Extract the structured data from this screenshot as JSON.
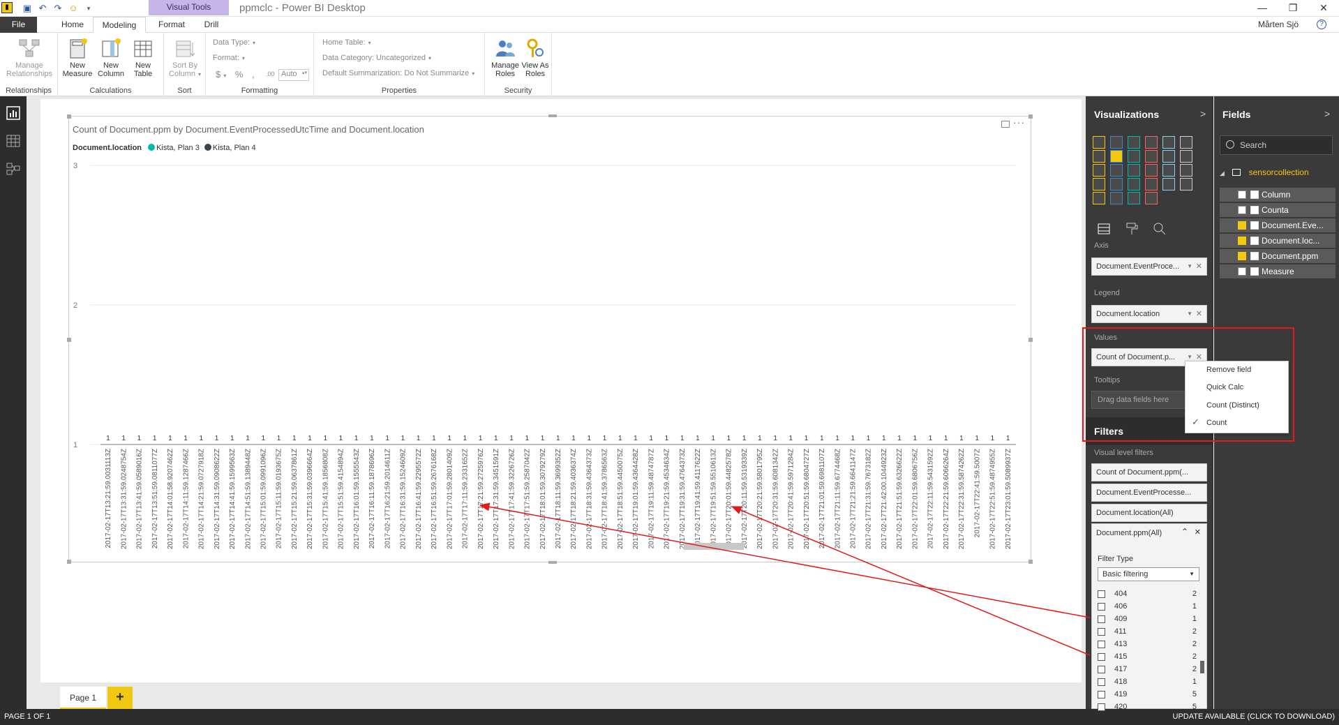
{
  "titlebar": {
    "app_icon": "pbi",
    "context_tab": "Visual Tools",
    "title": "ppmclc - Power BI Desktop",
    "quick_access": [
      "save-icon",
      "undo-icon",
      "redo-icon",
      "smiley-icon"
    ],
    "window_buttons": [
      "—",
      "❐",
      "✕"
    ]
  },
  "ribbon_tabs": [
    "File",
    "Home",
    "Modeling",
    "Format",
    "Drill"
  ],
  "user_name": "Mårten Sjö",
  "ribbon": {
    "relationships": {
      "button": "Manage Relationships",
      "group": "Relationships"
    },
    "calculations": {
      "new_measure": "New Measure",
      "new_column": "New Column",
      "new_table": "New Table",
      "group": "Calculations"
    },
    "sort": {
      "button": "Sort By Column",
      "group": "Sort"
    },
    "formatting": {
      "data_type": "Data Type:",
      "format": "Format:",
      "currency": "$",
      "percent": "%",
      "comma": ",",
      "decimals": ".00",
      "auto": "Auto",
      "group": "Formatting"
    },
    "properties": {
      "home_table": "Home Table:",
      "data_category": "Data Category: Uncategorized",
      "default_summarization": "Default Summarization: Do Not Summarize",
      "group": "Properties"
    },
    "security": {
      "manage_roles": "Manage Roles",
      "view_as_roles": "View As Roles",
      "group": "Security"
    }
  },
  "chart": {
    "title": "Count of Document.ppm by Document.EventProcessedUtcTime and Document.location",
    "legend_title": "Document.location",
    "legend": [
      {
        "name": "Kista, Plan 3",
        "color": "#01b8aa"
      },
      {
        "name": "Kista, Plan 4",
        "color": "#374649"
      }
    ]
  },
  "chart_data": {
    "type": "bar",
    "title": "Count of Document.ppm by Document.EventProcessedUtcTime and Document.location",
    "ylim": [
      1,
      3
    ],
    "yticks": [
      1,
      2,
      3
    ],
    "series": [
      {
        "name": "Kista, Plan 3",
        "values": [
          1,
          1,
          1,
          1,
          1,
          1,
          1,
          1,
          1,
          1,
          1,
          1,
          1,
          1,
          1,
          1,
          1,
          1,
          1,
          1,
          1,
          1,
          1,
          1,
          1,
          1,
          1,
          1,
          1,
          1,
          1,
          1,
          1,
          1,
          1,
          1,
          1,
          1,
          1,
          1,
          1,
          1,
          1,
          1,
          1,
          1,
          1,
          1,
          1,
          1,
          1,
          1,
          1,
          1,
          1,
          1,
          1,
          1,
          1
        ]
      }
    ],
    "categories": [
      "2017-02-17T13:21:59.0031113Z",
      "2017-02-17T13:31:59.0248754Z",
      "2017-02-17T13:41:59.0589016Z",
      "2017-02-17T13:51:59.0811077Z",
      "2017-02-17T14:01:58.9207462Z",
      "2017-02-17T14:11:59.1287466Z",
      "2017-02-17T14:21:59.0727918Z",
      "2017-02-17T14:31:59.0908622Z",
      "2017-02-17T14:41:59.1599563Z",
      "2017-02-17T14:51:59.1389448Z",
      "2017-02-17T15:01:59.0991096Z",
      "2017-02-17T15:11:59.0193675Z",
      "2017-02-17T15:21:59.0637861Z",
      "2017-02-17T15:31:59.0396664Z",
      "2017-02-17T15:41:59.1856808Z",
      "2017-02-17T15:51:59.4154894Z",
      "2017-02-17T16:01:59.1555543Z",
      "2017-02-17T16:11:59.1878696Z",
      "2017-02-17T16:21:59.2014611Z",
      "2017-02-17T16:31:59.1524609Z",
      "2017-02-17T16:41:59.2295572Z",
      "2017-02-17T16:51:59.2676168Z",
      "2017-02-17T17:01:59.2801409Z",
      "2017-02-17T17:11:59.2331652Z",
      "2017-02-17T17:21:59.2725976Z",
      "2017-02-17T17:31:59.3451591Z",
      "2017-02-17T17:41:59.3226726Z",
      "2017-02-17T17:51:59.2587042Z",
      "2017-02-17T18:01:59.3079279Z",
      "2017-02-17T18:11:59.3699352Z",
      "2017-02-17T18:21:59.4036374Z",
      "2017-02-17T18:31:59.4364373Z",
      "2017-02-17T18:41:59.3786563Z",
      "2017-02-17T18:51:59.4450075Z",
      "2017-02-17T19:01:59.4364428Z",
      "2017-02-17T19:11:59.4874787Z",
      "2017-02-17T19:21:59.4534634Z",
      "2017-02-17T19:31:59.4764373Z",
      "2017-02-17T19:41:59.4117622Z",
      "2017-02-17T19:51:59.5510613Z",
      "2017-02-17T20:01:59.4482578Z",
      "2017-02-17T20:11:59.5319339Z",
      "2017-02-17T20:21:59.5801795Z",
      "2017-02-17T20:31:59.6081342Z",
      "2017-02-17T20:41:59.5971284Z",
      "2017-02-17T20:51:59.6804727Z",
      "2017-02-17T21:01:59.6981107Z",
      "2017-02-17T21:11:59.6774468Z",
      "2017-02-17T21:21:59.6641147Z",
      "2017-02-17T21:31:59.7673182Z",
      "2017-02-17T21:42:00.1044923Z",
      "2017-02-17T21:51:59.6326622Z",
      "2017-02-17T22:01:59.6806756Z",
      "2017-02-17T22:11:59.5431592Z",
      "2017-02-17T22:21:59.6066264Z",
      "2017-02-17T22:31:59.5874262Z",
      "2017-02-17T22:41:59.5007Z",
      "2017-02-17T22:51:59.4874955Z",
      "2017-02-17T23:01:59.5089937Z"
    ]
  },
  "page_tabs": {
    "page1": "Page 1",
    "add": "+"
  },
  "statusbar": {
    "page": "PAGE 1 OF 1",
    "update": "UPDATE AVAILABLE (CLICK TO DOWNLOAD)"
  },
  "viz_pane": {
    "title": "Visualizations",
    "chevron": ">",
    "axis_label": "Axis",
    "axis_field": "Document.EventProce...",
    "legend_label": "Legend",
    "legend_field": "Document.location",
    "values_label": "Values",
    "values_field": "Count of Document.p...",
    "tooltips_label": "Tooltips",
    "tooltips_drop": "Drag data fields here"
  },
  "context_menu": {
    "items": [
      "Remove field",
      "Quick Calc",
      "Count (Distinct)",
      "Count"
    ],
    "checked": "Count"
  },
  "filters": {
    "title": "Filters",
    "visual_level": "Visual level filters",
    "cards": [
      "Count of Document.ppm(...",
      "Document.EventProcesse...",
      "Document.location(All)"
    ],
    "expanded_title": "Document.ppm(All)",
    "filter_type_label": "Filter Type",
    "filter_type_value": "Basic filtering",
    "values": [
      {
        "v": "404",
        "c": "2"
      },
      {
        "v": "406",
        "c": "1"
      },
      {
        "v": "409",
        "c": "1"
      },
      {
        "v": "411",
        "c": "2"
      },
      {
        "v": "413",
        "c": "2"
      },
      {
        "v": "415",
        "c": "2"
      },
      {
        "v": "417",
        "c": "2"
      },
      {
        "v": "418",
        "c": "1"
      },
      {
        "v": "419",
        "c": "5"
      },
      {
        "v": "420",
        "c": "5"
      }
    ]
  },
  "fields_pane": {
    "title": "Fields",
    "chevron": ">",
    "search_placeholder": "Search",
    "table": "sensorcollection",
    "fields": [
      {
        "name": "Column",
        "checked": false
      },
      {
        "name": "Counta",
        "checked": false
      },
      {
        "name": "Document.Eve...",
        "checked": true
      },
      {
        "name": "Document.loc...",
        "checked": true
      },
      {
        "name": "Document.ppm",
        "checked": true
      },
      {
        "name": "Measure",
        "checked": false
      }
    ]
  }
}
